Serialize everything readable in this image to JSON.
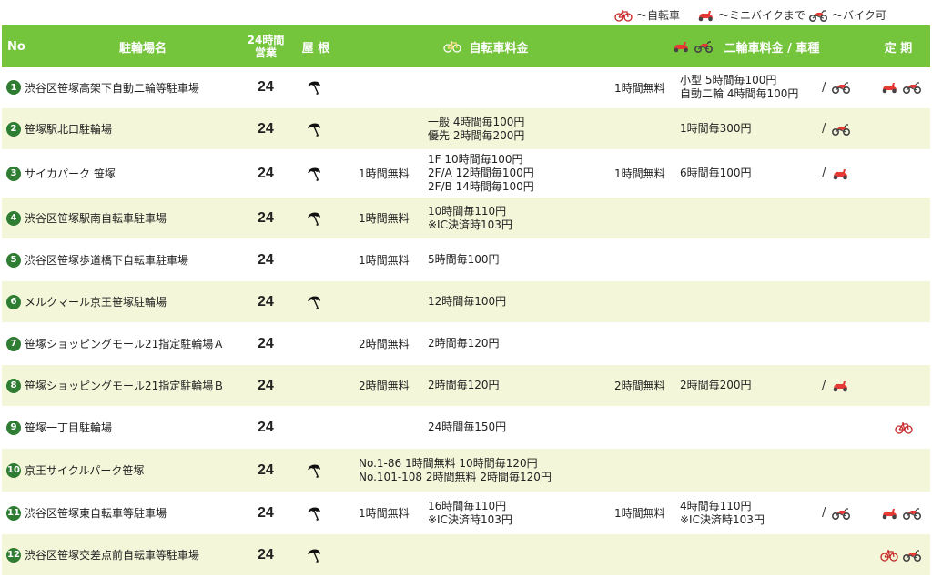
{
  "legend": {
    "bicycle": "～自転車",
    "mini": "～ミニバイクまで",
    "bike": "～バイク可"
  },
  "header": {
    "no": "No",
    "name": "駐輪場名",
    "hours_line1": "24時間",
    "hours_line2": "営業",
    "roof": "屋 根",
    "bicycle_fee": "自転車料金",
    "moto_fee": "二輪車料金 / 車種",
    "pass": "定 期"
  },
  "colors": {
    "header_bg": "#74c43c",
    "alt_row": "#f3f6d9",
    "number_badge": "#2e7d32",
    "icon_red": "#e53935"
  },
  "rows": [
    {
      "no": "1",
      "name": "渋谷区笹塚高架下自動二輪等駐車場",
      "hours": "24",
      "roof": true,
      "bike_free": "",
      "bike_fee": [],
      "moto_free": "1時間無料",
      "moto_fee": [
        "小型 5時間毎100円",
        "自動二輪 4時間毎100円"
      ],
      "moto_type": [
        "bike"
      ],
      "pass": [
        "mini",
        "bike"
      ]
    },
    {
      "no": "2",
      "name": "笹塚駅北口駐輪場",
      "hours": "24",
      "roof": true,
      "bike_free": "",
      "bike_fee": [
        "一般 4時間毎100円",
        "優先 2時間毎200円"
      ],
      "moto_free": "",
      "moto_fee": [
        "1時間毎300円"
      ],
      "moto_type": [
        "bike"
      ],
      "pass": []
    },
    {
      "no": "3",
      "name": "サイカパーク 笹塚",
      "hours": "24",
      "roof": true,
      "bike_free": "1時間無料",
      "bike_fee": [
        "1F 10時間毎100円",
        "2F/A 12時間毎100円",
        "2F/B 14時間毎100円"
      ],
      "moto_free": "1時間無料",
      "moto_fee": [
        "6時間毎100円"
      ],
      "moto_type": [
        "mini"
      ],
      "pass": []
    },
    {
      "no": "4",
      "name": "渋谷区笹塚駅南自転車駐車場",
      "hours": "24",
      "roof": true,
      "bike_free": "1時間無料",
      "bike_fee": [
        "10時間毎110円",
        "※IC決済時103円"
      ],
      "moto_free": "",
      "moto_fee": [],
      "moto_type": [],
      "pass": []
    },
    {
      "no": "5",
      "name": "渋谷区笹塚歩道橋下自転車駐車場",
      "hours": "24",
      "roof": false,
      "bike_free": "1時間無料",
      "bike_fee": [
        "5時間毎100円"
      ],
      "moto_free": "",
      "moto_fee": [],
      "moto_type": [],
      "pass": []
    },
    {
      "no": "6",
      "name": "メルクマール京王笹塚駐輪場",
      "hours": "24",
      "roof": true,
      "bike_free": "",
      "bike_fee": [
        "12時間毎100円"
      ],
      "moto_free": "",
      "moto_fee": [],
      "moto_type": [],
      "pass": []
    },
    {
      "no": "7",
      "name": "笹塚ショッピングモール21指定駐輪場Ａ",
      "hours": "24",
      "roof": false,
      "bike_free": "2時間無料",
      "bike_fee": [
        "2時間毎120円"
      ],
      "moto_free": "",
      "moto_fee": [],
      "moto_type": [],
      "pass": []
    },
    {
      "no": "8",
      "name": "笹塚ショッピングモール21指定駐輪場Ｂ",
      "hours": "24",
      "roof": false,
      "bike_free": "2時間無料",
      "bike_fee": [
        "2時間毎120円"
      ],
      "moto_free": "2時間無料",
      "moto_fee": [
        "2時間毎200円"
      ],
      "moto_type": [
        "mini"
      ],
      "pass": []
    },
    {
      "no": "9",
      "name": "笹塚一丁目駐輪場",
      "hours": "24",
      "roof": false,
      "bike_free": "",
      "bike_fee": [
        "24時間毎150円"
      ],
      "moto_free": "",
      "moto_fee": [],
      "moto_type": [],
      "pass": [
        "bicycle"
      ]
    },
    {
      "no": "10",
      "name": "京王サイクルパーク笹塚",
      "hours": "24",
      "roof": true,
      "bike_free": "",
      "bike_fee_wide": [
        "No.1-86 1時間無料 10時間毎120円",
        "No.101-108 2時間無料 2時間毎120円"
      ],
      "bike_fee": [],
      "moto_free": "",
      "moto_fee": [],
      "moto_type": [],
      "pass": []
    },
    {
      "no": "11",
      "name": "渋谷区笹塚東自転車等駐車場",
      "hours": "24",
      "roof": true,
      "bike_free": "1時間無料",
      "bike_fee": [
        "16時間毎110円",
        "※IC決済時103円"
      ],
      "moto_free": "1時間無料",
      "moto_fee": [
        "4時間毎110円",
        "※IC決済時103円"
      ],
      "moto_type": [
        "bike"
      ],
      "pass": [
        "mini",
        "bike"
      ]
    },
    {
      "no": "12",
      "name": "渋谷区笹塚交差点前自転車等駐車場",
      "hours": "24",
      "roof": true,
      "bike_free": "",
      "bike_fee": [],
      "moto_free": "",
      "moto_fee": [],
      "moto_type": [],
      "pass": [
        "bicycle",
        "bike"
      ]
    }
  ]
}
